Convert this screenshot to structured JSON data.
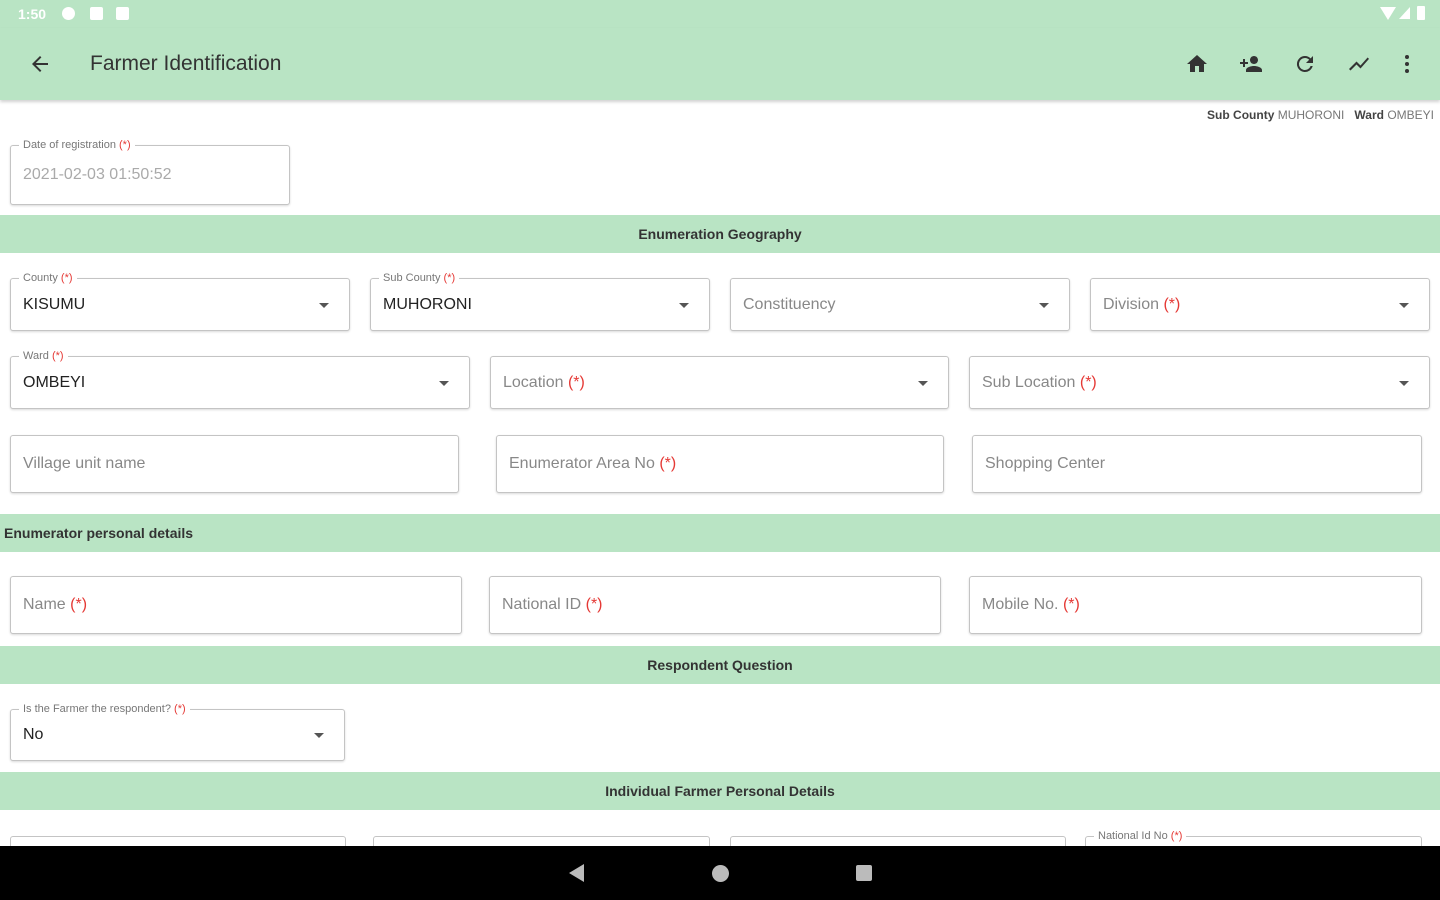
{
  "status_bar": {
    "time": "1:50"
  },
  "app_bar": {
    "title": "Farmer Identification",
    "actions": [
      "home-icon",
      "add-person-icon",
      "refresh-icon",
      "trend-icon",
      "more-vert-icon"
    ]
  },
  "sub_info": {
    "sub_county_label": "Sub County",
    "sub_county_value": "MUHORONI",
    "ward_label": "Ward",
    "ward_value": "OMBEYI"
  },
  "registration": {
    "label": "Date of registration",
    "required": "(*)",
    "value": "2021-02-03 01:50:52"
  },
  "sections": {
    "geography": "Enumeration Geography",
    "enumerator": "Enumerator personal details",
    "respondent": "Respondent Question",
    "individual": "Individual Farmer Personal Details"
  },
  "geo_fields": {
    "county": {
      "label": "County",
      "required": "(*)",
      "value": "KISUMU"
    },
    "sub_county": {
      "label": "Sub County",
      "required": "(*)",
      "value": "MUHORONI"
    },
    "constituency": {
      "placeholder": "Constituency"
    },
    "division": {
      "placeholder": "Division",
      "required": "(*)"
    },
    "ward": {
      "label": "Ward",
      "required": "(*)",
      "value": "OMBEYI"
    },
    "location": {
      "placeholder": "Location",
      "required": "(*)"
    },
    "sub_location": {
      "placeholder": "Sub Location",
      "required": "(*)"
    },
    "village": {
      "placeholder": "Village unit name"
    },
    "enum_area": {
      "placeholder": "Enumerator Area No",
      "required": "(*)"
    },
    "shopping": {
      "placeholder": "Shopping Center"
    }
  },
  "enumerator_fields": {
    "name": {
      "placeholder": "Name",
      "required": "(*)"
    },
    "national_id": {
      "placeholder": "National ID",
      "required": "(*)"
    },
    "mobile": {
      "placeholder": "Mobile No.",
      "required": "(*)"
    }
  },
  "respondent": {
    "label": "Is the Farmer the respondent?",
    "required": "(*)",
    "value": "No"
  },
  "individual_fields": {
    "national_id_label": "National Id No",
    "required": "(*)"
  },
  "colors": {
    "accent": "#b9e4c4",
    "required": "#e53935"
  }
}
